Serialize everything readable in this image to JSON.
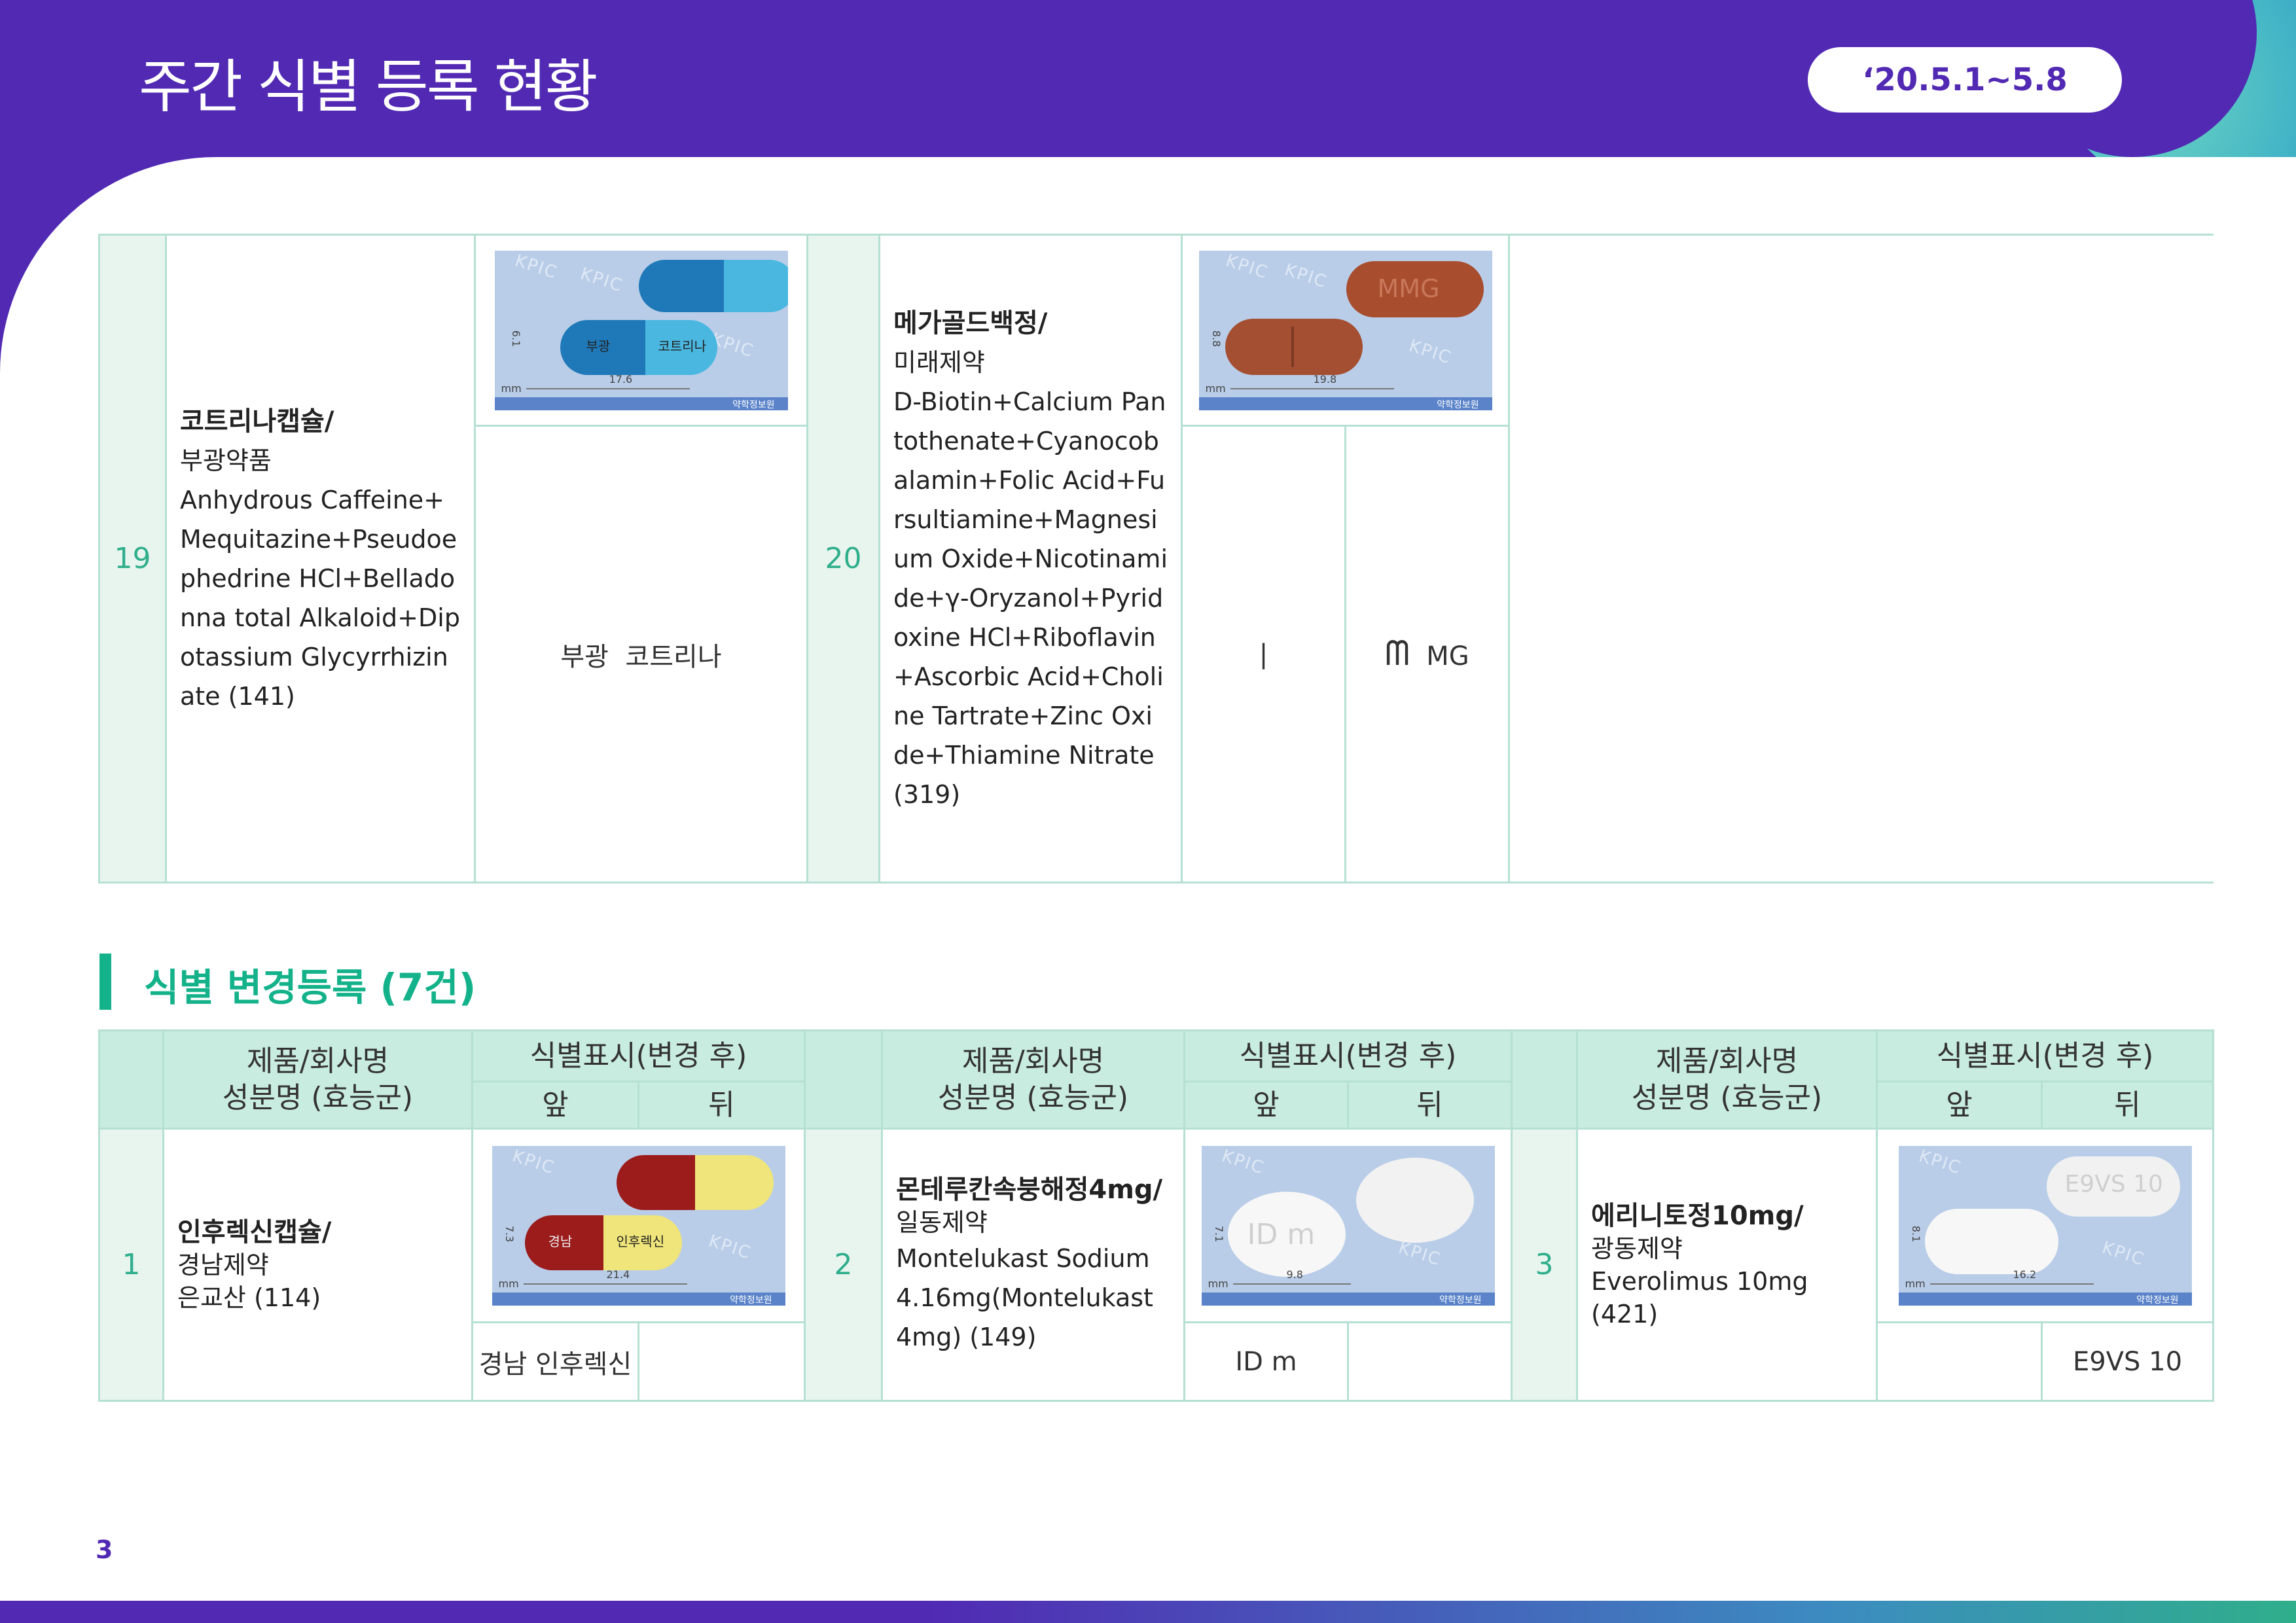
{
  "header": {
    "title": "주간 식별 등록 현황",
    "date_range": "‘20.5.1~5.8"
  },
  "new_registrations": [
    {
      "no": "19",
      "product": "코트리나캡슐/",
      "company": "부광약품",
      "ingredients": "Anhydrous Caffeine+Mequitazine+Pseudoephedrine HCl+Belladonna total Alkaloid+Dipotassium Glycyrrhizinate (141)",
      "mark_front": "부광",
      "mark_back": "코트리나",
      "photo": {
        "size_h": "6.1",
        "size_w": "17.6",
        "unit": "mm",
        "imprint_left": "부광",
        "imprint_right": "코트리나",
        "watermark": "KPIC",
        "footer": "약학정보원"
      }
    },
    {
      "no": "20",
      "product": "메가골드백정/",
      "company": "미래제약",
      "ingredients": "D-Biotin+Calcium Pantothenate+Cyanocobalamin+Folic Acid+Fursultiamine+Magnesium Oxide+Nicotinamide+γ-Oryzanol+Pyridoxine HCl+Riboflavin+Ascorbic Acid+Choline Tartrate+Zinc Oxide+Thiamine Nitrate (319)",
      "mark_front": "|",
      "mark_back_symbol": "ᗰ",
      "mark_back": "MG",
      "photo": {
        "size_h": "8.8",
        "size_w": "19.8",
        "unit": "mm",
        "imprint": "MMG",
        "watermark": "KPIC",
        "footer": "약학정보원"
      }
    }
  ],
  "section": {
    "title": "식별 변경등록 (7건)"
  },
  "changes_table": {
    "headers": {
      "product_line1": "제품/회사명",
      "product_line2": "성분명 (효능군)",
      "mark_group": "식별표시(변경 후)",
      "front": "앞",
      "back": "뒤"
    },
    "rows": [
      {
        "no": "1",
        "product": "인후렉신캡슐/",
        "company": "경남제약",
        "ingredients": "은교산 (114)",
        "mark_front": "경남  인후렉신",
        "mark_back": "",
        "photo": {
          "size_h": "7.3",
          "size_w": "21.4",
          "unit": "mm",
          "imprint_left": "경남",
          "imprint_right": "인후렉신",
          "watermark": "KPIC",
          "footer": "약학정보원"
        }
      },
      {
        "no": "2",
        "product": "몬테루칸속붕해정4mg/",
        "company": "일동제약",
        "ingredients": "Montelukast Sodium 4.16mg(Montelukast 4mg) (149)",
        "mark_front": "ID  m",
        "mark_back": "",
        "photo": {
          "size_h": "7.1",
          "size_w": "9.8",
          "unit": "mm",
          "imprint": "ID m",
          "watermark": "KPIC",
          "footer": "약학정보원"
        }
      },
      {
        "no": "3",
        "product": "에리니토정10mg/",
        "company": "광동제약",
        "ingredients": "Everolimus 10mg (421)",
        "mark_front": "",
        "mark_back": "E9VS  10",
        "photo": {
          "size_h": "8.1",
          "size_w": "16.2",
          "unit": "mm",
          "imprint": "E9VS 10",
          "watermark": "KPIC",
          "footer": "약학정보원"
        }
      }
    ]
  },
  "footer": {
    "page_number": "3"
  },
  "colors": {
    "brand_purple": "#5129b3",
    "accent_green": "#14b28a",
    "header_mint": "#c9ece0",
    "border_mint": "#b5e0d3"
  }
}
